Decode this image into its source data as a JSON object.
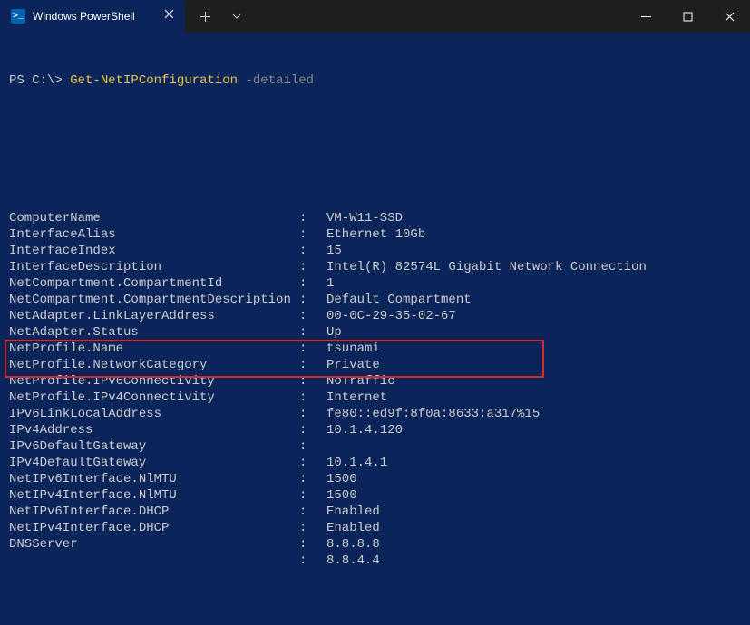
{
  "tab": {
    "title": "Windows PowerShell",
    "icon_label": ">_"
  },
  "prompt": {
    "prefix": "PS C:\\>",
    "command": "Get-NetIPConfiguration",
    "param": "-detailed"
  },
  "rows": [
    {
      "key": "ComputerName",
      "val": "VM-W11-SSD",
      "hl": false
    },
    {
      "key": "InterfaceAlias",
      "val": "Ethernet 10Gb",
      "hl": false
    },
    {
      "key": "InterfaceIndex",
      "val": "15",
      "hl": false
    },
    {
      "key": "InterfaceDescription",
      "val": "Intel(R) 82574L Gigabit Network Connection",
      "hl": false
    },
    {
      "key": "NetCompartment.CompartmentId",
      "val": "1",
      "hl": false
    },
    {
      "key": "NetCompartment.CompartmentDescription",
      "val": "Default Compartment",
      "hl": false
    },
    {
      "key": "NetAdapter.LinkLayerAddress",
      "val": "00-0C-29-35-02-67",
      "hl": false
    },
    {
      "key": "NetAdapter.Status",
      "val": "Up",
      "hl": false
    },
    {
      "key": "NetProfile.Name",
      "val": "tsunami",
      "hl": false
    },
    {
      "key": "NetProfile.NetworkCategory",
      "val": "Private",
      "hl": false
    },
    {
      "key": "NetProfile.IPv6Connectivity",
      "val": "NoTraffic",
      "hl": false
    },
    {
      "key": "NetProfile.IPv4Connectivity",
      "val": "Internet",
      "hl": false
    },
    {
      "key": "IPv6LinkLocalAddress",
      "val": "fe80::ed9f:8f0a:8633:a317%15",
      "hl": true
    },
    {
      "key": "IPv4Address",
      "val": "10.1.4.120",
      "hl": true
    },
    {
      "key": "IPv6DefaultGateway",
      "val": "",
      "hl": false
    },
    {
      "key": "IPv4DefaultGateway",
      "val": "10.1.4.1",
      "hl": false
    },
    {
      "key": "NetIPv6Interface.NlMTU",
      "val": "1500",
      "hl": false
    },
    {
      "key": "NetIPv4Interface.NlMTU",
      "val": "1500",
      "hl": false
    },
    {
      "key": "NetIPv6Interface.DHCP",
      "val": "Enabled",
      "hl": false
    },
    {
      "key": "NetIPv4Interface.DHCP",
      "val": "Enabled",
      "hl": false
    },
    {
      "key": "DNSServer",
      "val": "8.8.8.8",
      "hl": false
    },
    {
      "key": "",
      "val": "8.8.4.4",
      "hl": false
    }
  ]
}
